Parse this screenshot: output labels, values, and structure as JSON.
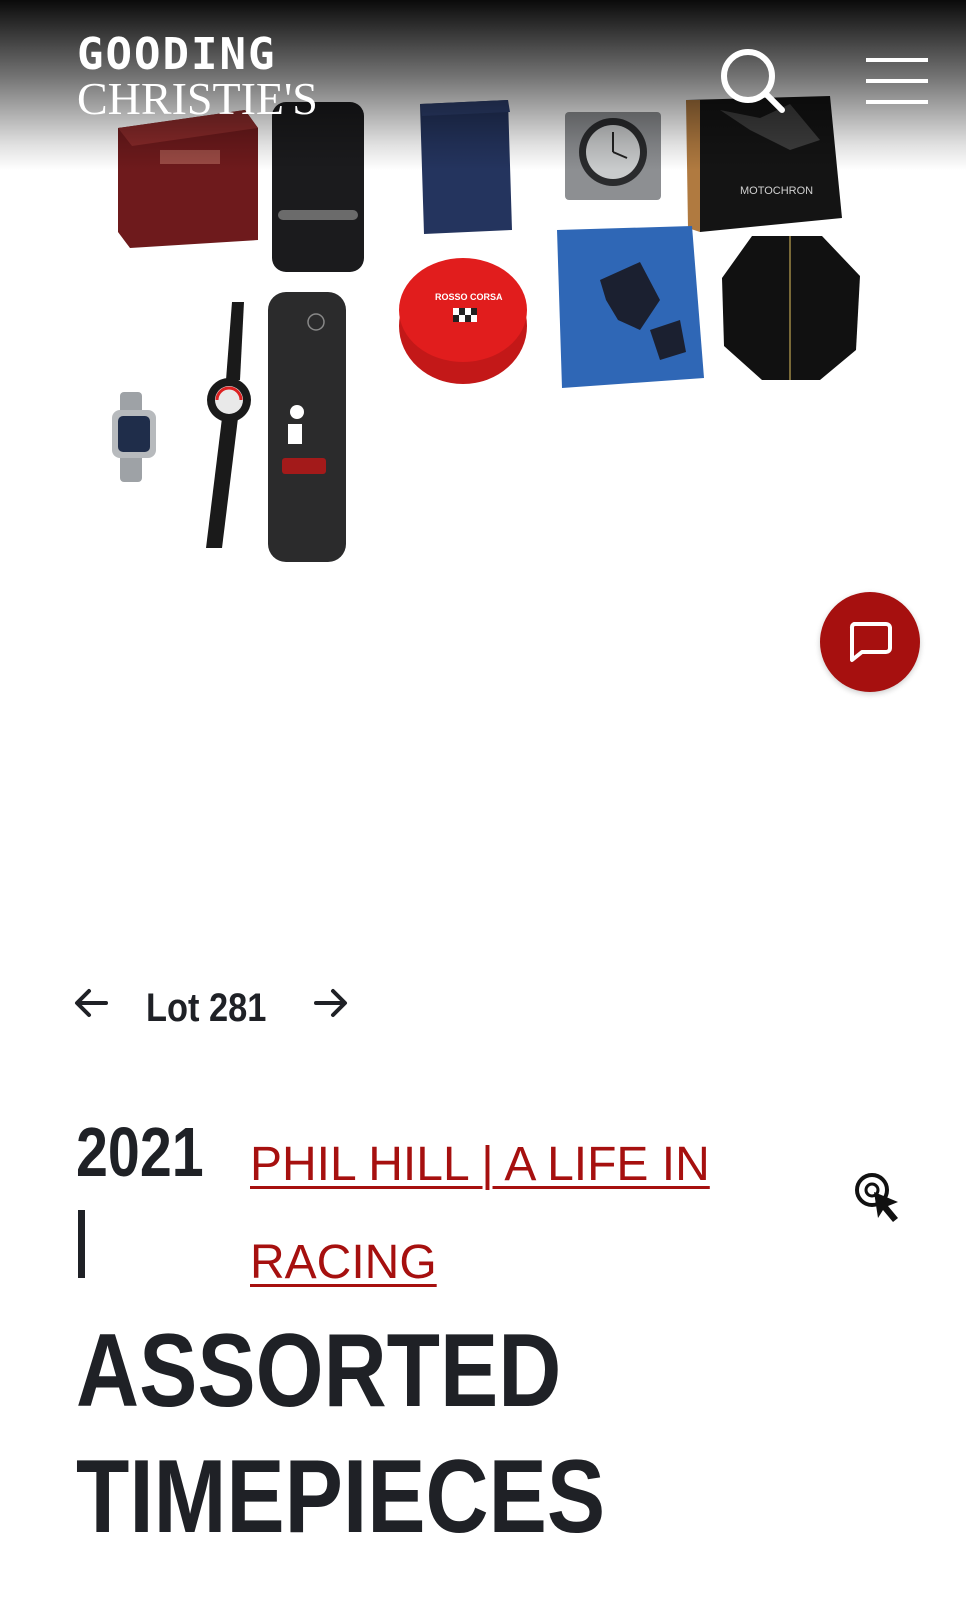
{
  "header": {
    "logo_line1": "GOODING",
    "logo_line2": "CHRISTIE'S",
    "icons": [
      "search-icon",
      "hamburger-menu-icon"
    ]
  },
  "photo": {
    "printed_labels": [
      "MOTOCHRON",
      "ROSSO CORSA"
    ]
  },
  "chat": {
    "icon": "chat-bubble-icon",
    "color": "#a6100f"
  },
  "lot_nav": {
    "label": "Lot 281",
    "prev_icon": "arrow-left-icon",
    "next_icon": "arrow-right-icon"
  },
  "sale": {
    "year": "2021",
    "separator": "|",
    "link_text": "PHIL HILL | A LIFE IN RACING",
    "link_color": "#a6100f"
  },
  "lot": {
    "title_line1": "ASSORTED",
    "title_line2": "TIMEPIECES"
  },
  "colors": {
    "accent": "#a6100f",
    "text": "#1f2126"
  }
}
